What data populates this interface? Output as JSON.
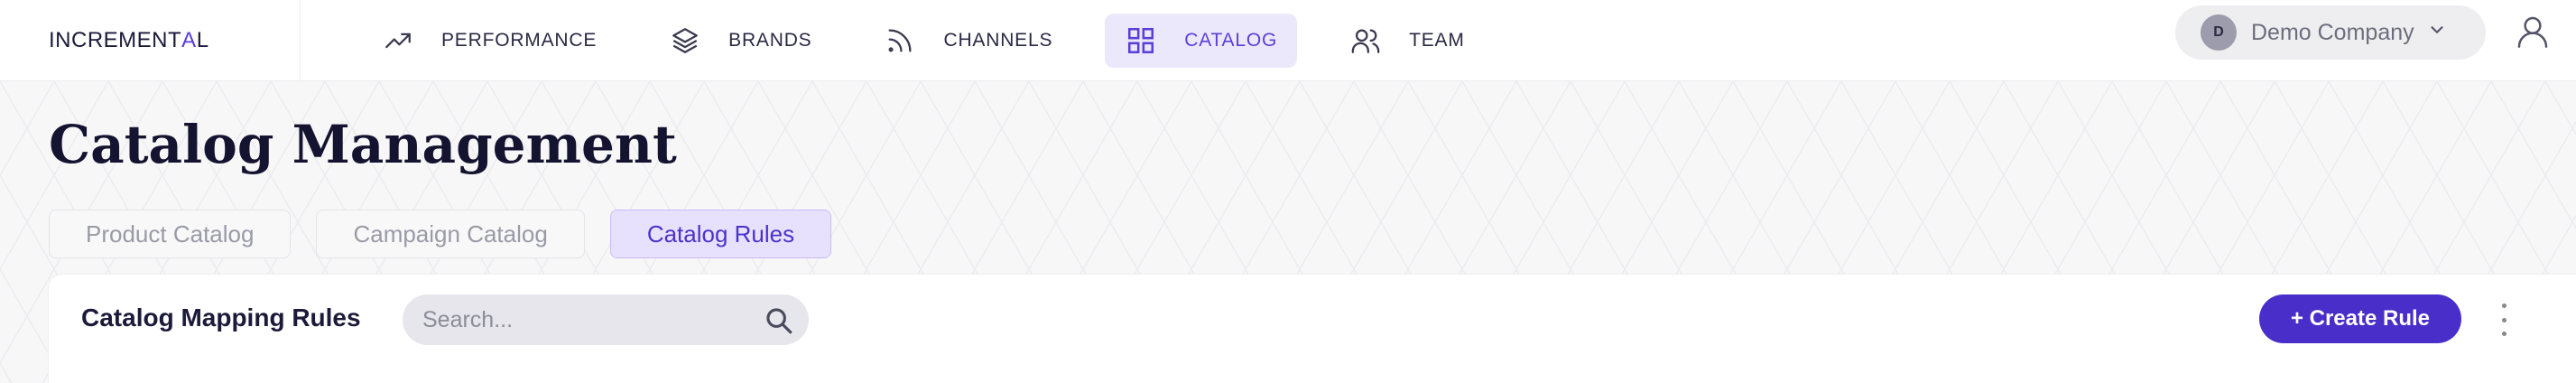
{
  "brand": {
    "logo_text_prefix": "INCREMENT",
    "logo_text_accent": "A",
    "logo_text_suffix": "L",
    "accent_color": "#5b3fd6"
  },
  "nav": {
    "items": [
      {
        "label": "PERFORMANCE",
        "icon": "trend-up-icon",
        "active": false
      },
      {
        "label": "BRANDS",
        "icon": "layers-icon",
        "active": false
      },
      {
        "label": "CHANNELS",
        "icon": "rss-icon",
        "active": false
      },
      {
        "label": "CATALOG",
        "icon": "grid-icon",
        "active": true
      },
      {
        "label": "TEAM",
        "icon": "users-icon",
        "active": false
      }
    ]
  },
  "company": {
    "avatar_initial": "D",
    "name": "Demo Company"
  },
  "page": {
    "title": "Catalog Management"
  },
  "tabs": [
    {
      "label": "Product Catalog",
      "active": false
    },
    {
      "label": "Campaign Catalog",
      "active": false
    },
    {
      "label": "Catalog Rules",
      "active": true
    }
  ],
  "card": {
    "title": "Catalog Mapping Rules",
    "search_placeholder": "Search...",
    "create_label": "+ Create Rule"
  },
  "colors": {
    "primary_button": "#4a2ec9",
    "active_tab_bg": "#e8e1fd",
    "active_nav_bg": "#ece8fb"
  }
}
